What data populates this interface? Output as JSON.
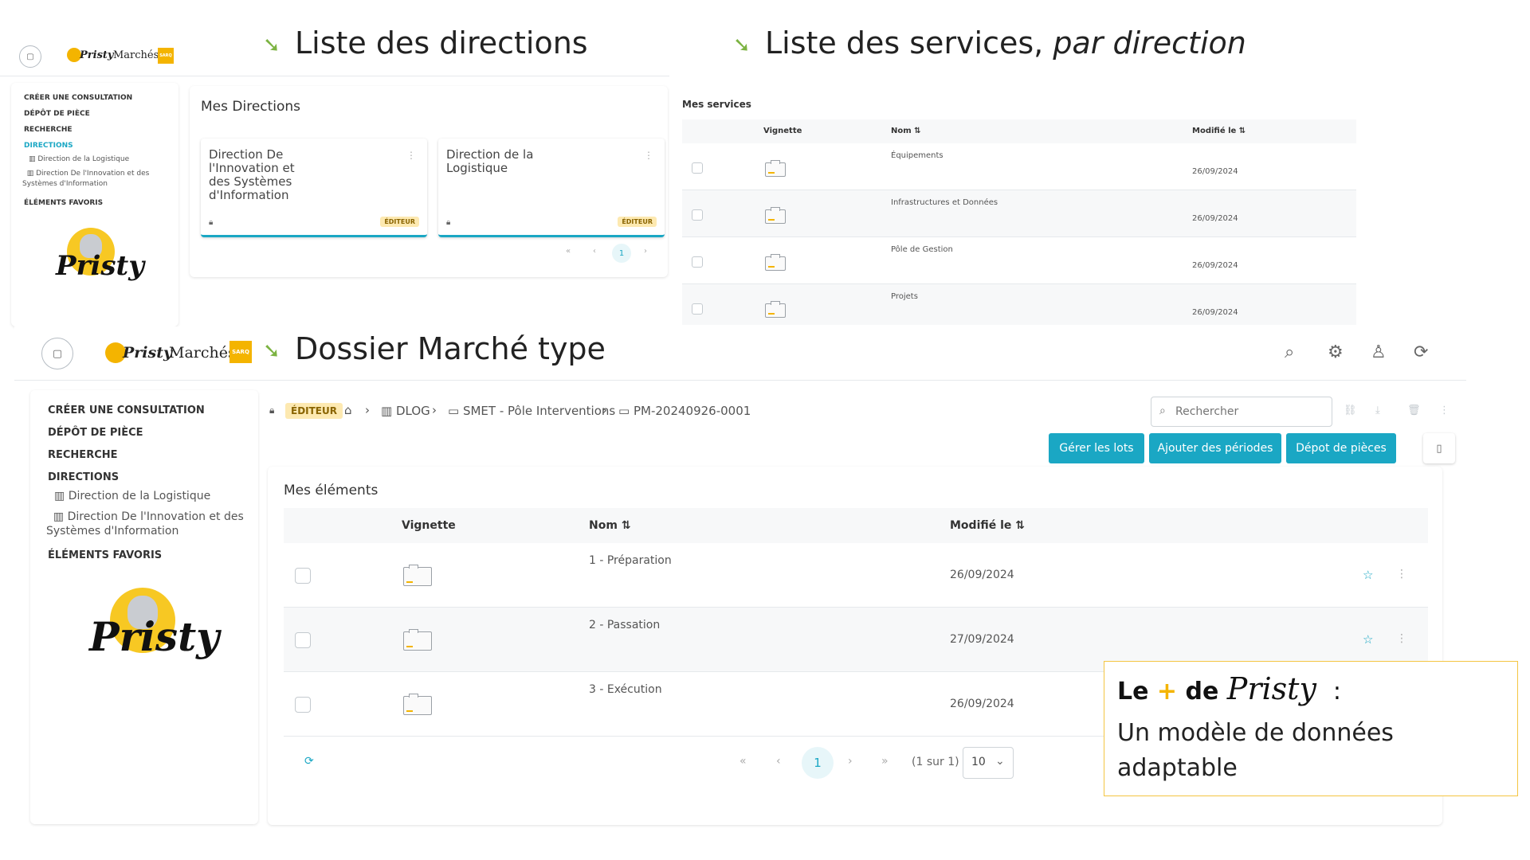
{
  "headings": {
    "directions": "Liste des directions",
    "services_main": "Liste des services,",
    "services_italic": "par direction",
    "dossier": "Dossier Marché type"
  },
  "logo": {
    "brand": "Pristy",
    "product": "Marchés",
    "badge": "SARQ"
  },
  "sidebar": {
    "create": "CRÉER UNE CONSULTATION",
    "deposit": "DÉPÔT DE PIÈCE",
    "search": "RECHERCHE",
    "directions": "DIRECTIONS",
    "dir1": "Direction de la Logistique",
    "dir2": "Direction De l'Innovation et des Systèmes d'Information",
    "favorites": "ÉLÉMENTS FAVORIS"
  },
  "mes_directions": {
    "title": "Mes Directions",
    "cards": [
      {
        "name": "Direction De l'Innovation et des Systèmes d'Information",
        "badge": "ÉDITEUR"
      },
      {
        "name": "Direction de la Logistique",
        "badge": "ÉDITEUR"
      }
    ],
    "page": "1"
  },
  "mes_services": {
    "title": "Mes services",
    "columns": {
      "thumb": "Vignette",
      "name": "Nom",
      "modified": "Modifié le"
    },
    "rows": [
      {
        "name": "Équipements",
        "date": "26/09/2024"
      },
      {
        "name": "Infrastructures et Données",
        "date": "26/09/2024"
      },
      {
        "name": "Pôle de Gestion",
        "date": "26/09/2024"
      },
      {
        "name": "Projets",
        "date": "26/09/2024"
      }
    ]
  },
  "breadcrumb": {
    "role": "ÉDITEUR",
    "b1": "DLOG",
    "b2": "SMET - Pôle Interventions",
    "b3": "PM-20240926-0001"
  },
  "search": {
    "placeholder": "Rechercher"
  },
  "buttons": {
    "lots": "Gérer les lots",
    "periods": "Ajouter des périodes",
    "deposit": "Dépot de pièces"
  },
  "mes_elements": {
    "title": "Mes éléments",
    "columns": {
      "thumb": "Vignette",
      "name": "Nom",
      "modified": "Modifié le"
    },
    "rows": [
      {
        "name": "1 - Préparation",
        "date": "26/09/2024"
      },
      {
        "name": "2 - Passation",
        "date": "27/09/2024"
      },
      {
        "name": "3 - Exécution",
        "date": "26/09/2024"
      }
    ],
    "page": "1",
    "page_info": "(1 sur 1)",
    "page_size": "10"
  },
  "callout": {
    "le": "Le",
    "plus": "+",
    "de": "de",
    "brand": "Pristy",
    "colon": ":",
    "body": "Un modèle de données adaptable"
  },
  "colors": {
    "accent": "#1aa7c4",
    "badge_bg": "#fde9b1",
    "callout_border": "#f4c542",
    "arrow": "#7cb342"
  }
}
